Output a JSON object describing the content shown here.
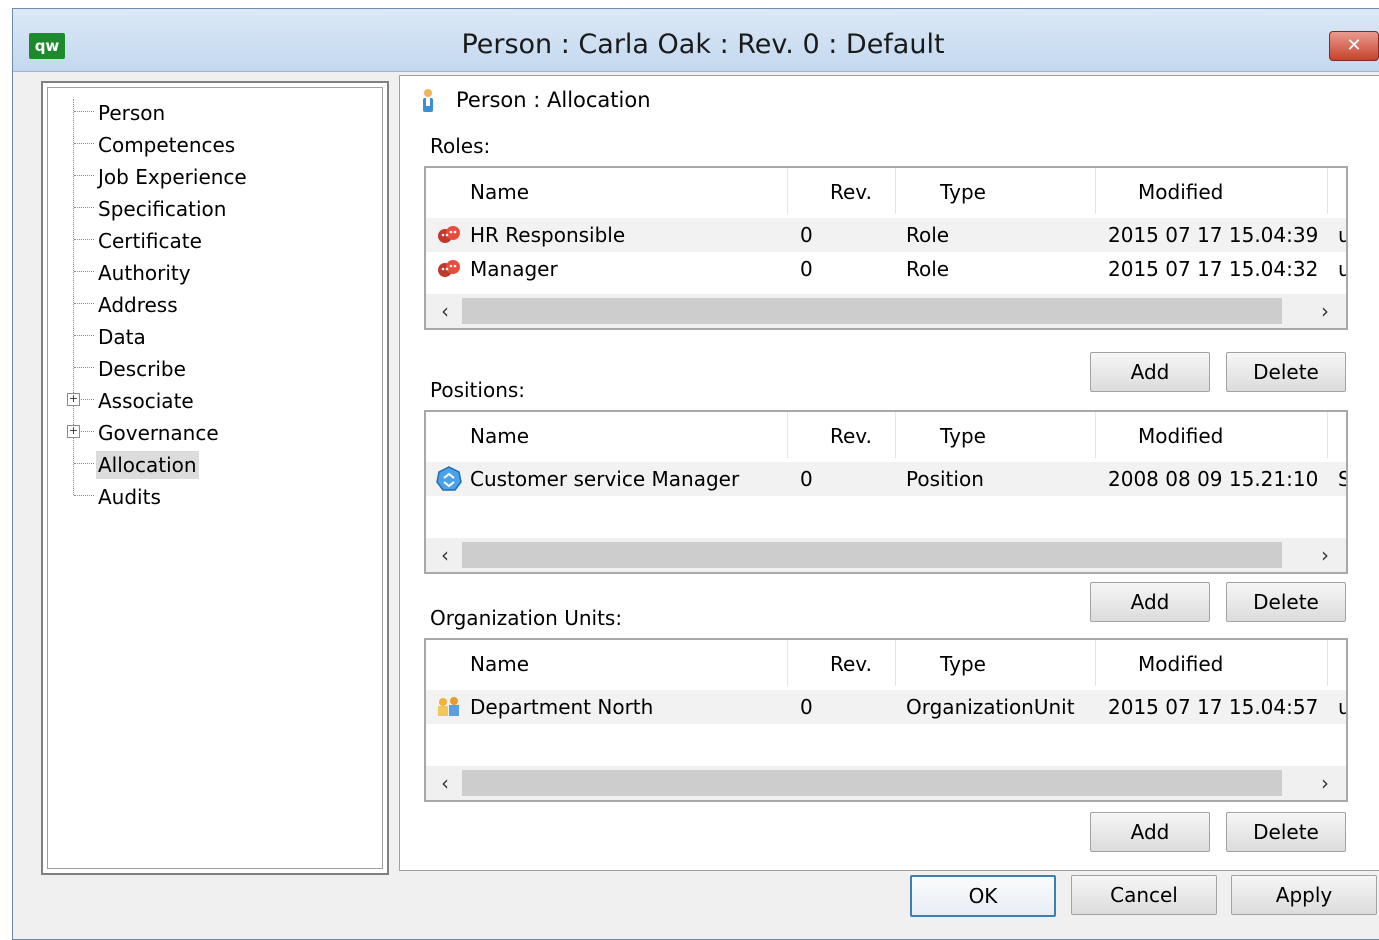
{
  "window": {
    "app_icon_text": "qw",
    "title": "Person : Carla Oak : Rev. 0  : Default",
    "close_label": "✕"
  },
  "tree": {
    "items": [
      {
        "label": "Person"
      },
      {
        "label": "Competences"
      },
      {
        "label": "Job Experience"
      },
      {
        "label": "Specification"
      },
      {
        "label": "Certificate"
      },
      {
        "label": "Authority"
      },
      {
        "label": "Address"
      },
      {
        "label": "Data"
      },
      {
        "label": "Describe"
      },
      {
        "label": "Associate",
        "expandable": true
      },
      {
        "label": "Governance",
        "expandable": true
      },
      {
        "label": "Allocation",
        "selected": true
      },
      {
        "label": "Audits"
      }
    ]
  },
  "panel": {
    "header": "Person : Allocation",
    "columns": {
      "name": "Name",
      "rev": "Rev.",
      "type": "Type",
      "modified": "Modified"
    },
    "roles": {
      "label": "Roles:",
      "rows": [
        {
          "icon": "role-masks-icon",
          "name": "HR Responsible",
          "rev": "0",
          "type": "Role",
          "modified": "2015 07 17 15.04:39",
          "extra": "u"
        },
        {
          "icon": "role-masks-icon",
          "name": "Manager",
          "rev": "0",
          "type": "Role",
          "modified": "2015 07 17 15.04:32",
          "extra": "u"
        }
      ]
    },
    "positions": {
      "label": "Positions:",
      "rows": [
        {
          "icon": "position-icon",
          "name": "Customer service Manager",
          "rev": "0",
          "type": "Position",
          "modified": "2008 08 09 15.21:10",
          "extra": "S"
        }
      ]
    },
    "org_units": {
      "label": "Organization Units:",
      "rows": [
        {
          "icon": "org-unit-icon",
          "name": "Department North",
          "rev": "0",
          "type": "OrganizationUnit",
          "modified": "2015 07 17 15.04:57",
          "extra": "u"
        }
      ]
    },
    "add_label": "Add",
    "delete_label": "Delete"
  },
  "footer": {
    "ok_label": "OK",
    "cancel_label": "Cancel",
    "apply_label": "Apply"
  },
  "colors": {
    "accent": "#3c7fb1",
    "close": "#c7422e",
    "selection": "#dcdcdc"
  }
}
